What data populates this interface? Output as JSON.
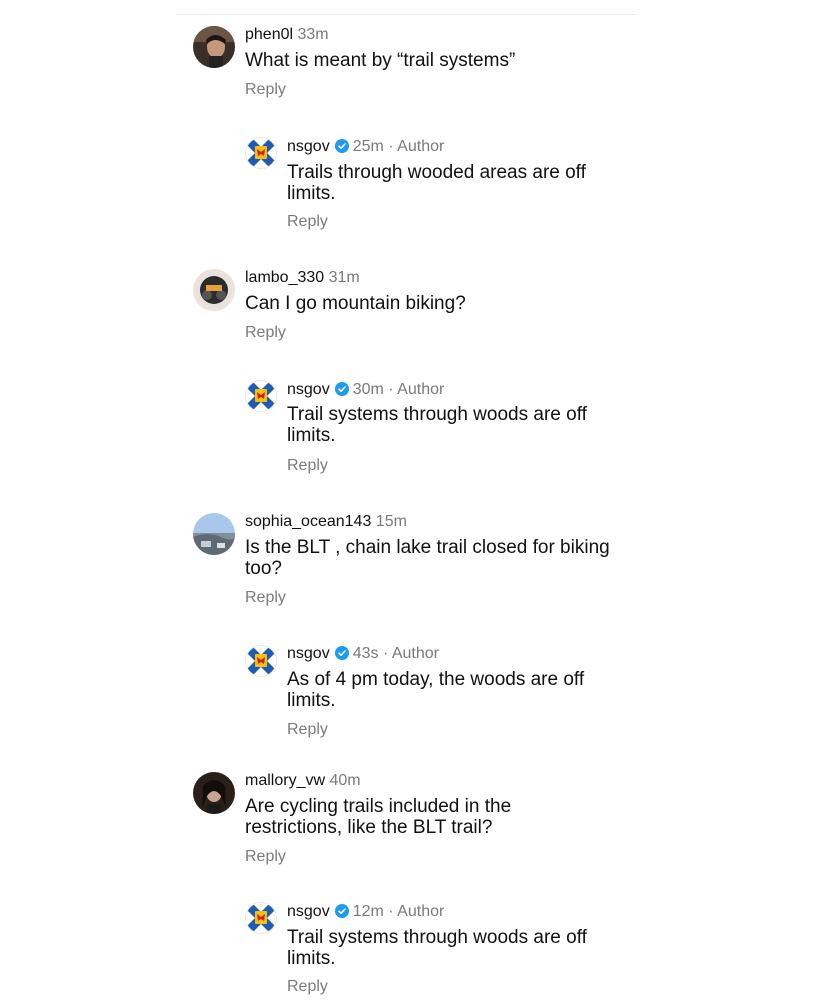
{
  "thread": [
    {
      "username": "phen0l",
      "time": "33m",
      "text": "What is meant by “trail systems”",
      "reply_label": "Reply"
    },
    {
      "username": "nsgov",
      "time": "25m",
      "author_tag": "Author",
      "text": "Trails through wooded areas are off limits.",
      "reply_label": "Reply"
    },
    {
      "username": "lambo_330",
      "time": "31m",
      "text": "Can I go mountain biking?",
      "reply_label": "Reply"
    },
    {
      "username": "nsgov",
      "time": "30m",
      "author_tag": "Author",
      "text": "Trail systems through woods are off limits.",
      "reply_label": "Reply"
    },
    {
      "username": "sophia_ocean143",
      "time": "15m",
      "text": "Is the BLT , chain lake trail closed for biking too?",
      "reply_label": "Reply"
    },
    {
      "username": "nsgov",
      "time": "43s",
      "author_tag": "Author",
      "text": "As of 4 pm today, the woods are off limits.",
      "reply_label": "Reply"
    },
    {
      "username": "mallory_vw",
      "time": "40m",
      "text": "Are cycling trails included in the restrictions, like the BLT trail?",
      "reply_label": "Reply"
    },
    {
      "username": "nsgov",
      "time": "12m",
      "author_tag": "Author",
      "text": "Trail systems through woods are off limits.",
      "reply_label": "Reply"
    }
  ],
  "separator": "·",
  "colors": {
    "verified": "#1d9bf0",
    "secondary_text": "#7a7a7a",
    "primary_text": "#111111"
  }
}
